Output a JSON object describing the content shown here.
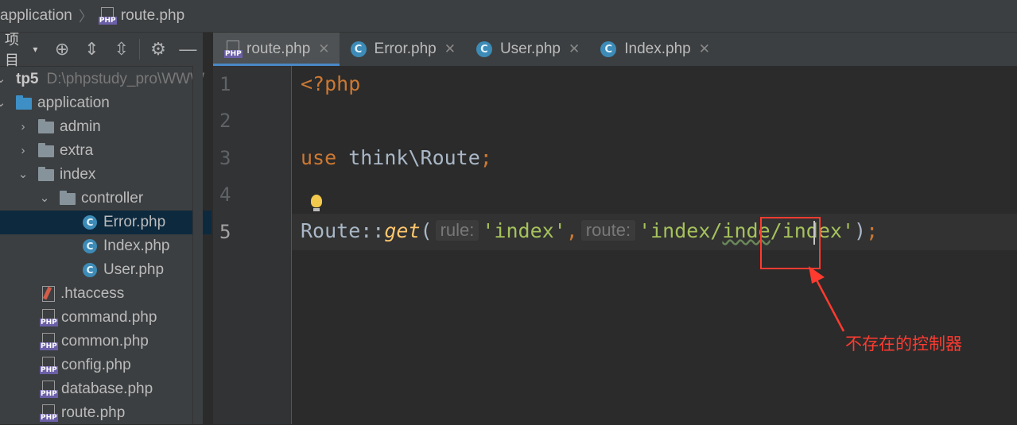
{
  "breadcrumb": {
    "parts": [
      "application",
      "route.php"
    ]
  },
  "sidebar": {
    "toolbar_title": "项目",
    "root": {
      "name": "tp5",
      "path": "D:\\phpstudy_pro\\WWW"
    },
    "items": [
      {
        "label": "application"
      },
      {
        "label": "admin"
      },
      {
        "label": "extra"
      },
      {
        "label": "index"
      },
      {
        "label": "controller"
      },
      {
        "label": "Error.php"
      },
      {
        "label": "Index.php"
      },
      {
        "label": "User.php"
      },
      {
        "label": ".htaccess"
      },
      {
        "label": "command.php"
      },
      {
        "label": "common.php"
      },
      {
        "label": "config.php"
      },
      {
        "label": "database.php"
      },
      {
        "label": "route.php"
      }
    ]
  },
  "tabs": [
    {
      "label": "route.php",
      "icon": "php-file-icon",
      "active": true
    },
    {
      "label": "Error.php",
      "icon": "class-icon"
    },
    {
      "label": "User.php",
      "icon": "class-icon"
    },
    {
      "label": "Index.php",
      "icon": "class-icon"
    }
  ],
  "editor": {
    "line_numbers": [
      "1",
      "2",
      "3",
      "4",
      "5"
    ],
    "line1": "<?php",
    "line3_kw": "use",
    "line3_rest": " think\\Route",
    "line3_semi": ";",
    "line5": {
      "cls": "Route::",
      "fn": "get",
      "paren": "(",
      "hint1": "rule:",
      "arg1": "'index'",
      "comma": ",",
      "hint2": "route:",
      "arg2_a": "'index/",
      "arg2_b": "inde",
      "arg2_c": "/index'",
      "close": ")",
      "semi": ";"
    }
  },
  "annotation": {
    "text": "不存在的控制器",
    "color": "#ff3b30"
  },
  "colors": {
    "accent": "#4a88c7",
    "selection": "#0d293e",
    "keyword": "#cc7832",
    "string": "#a5c25c"
  }
}
